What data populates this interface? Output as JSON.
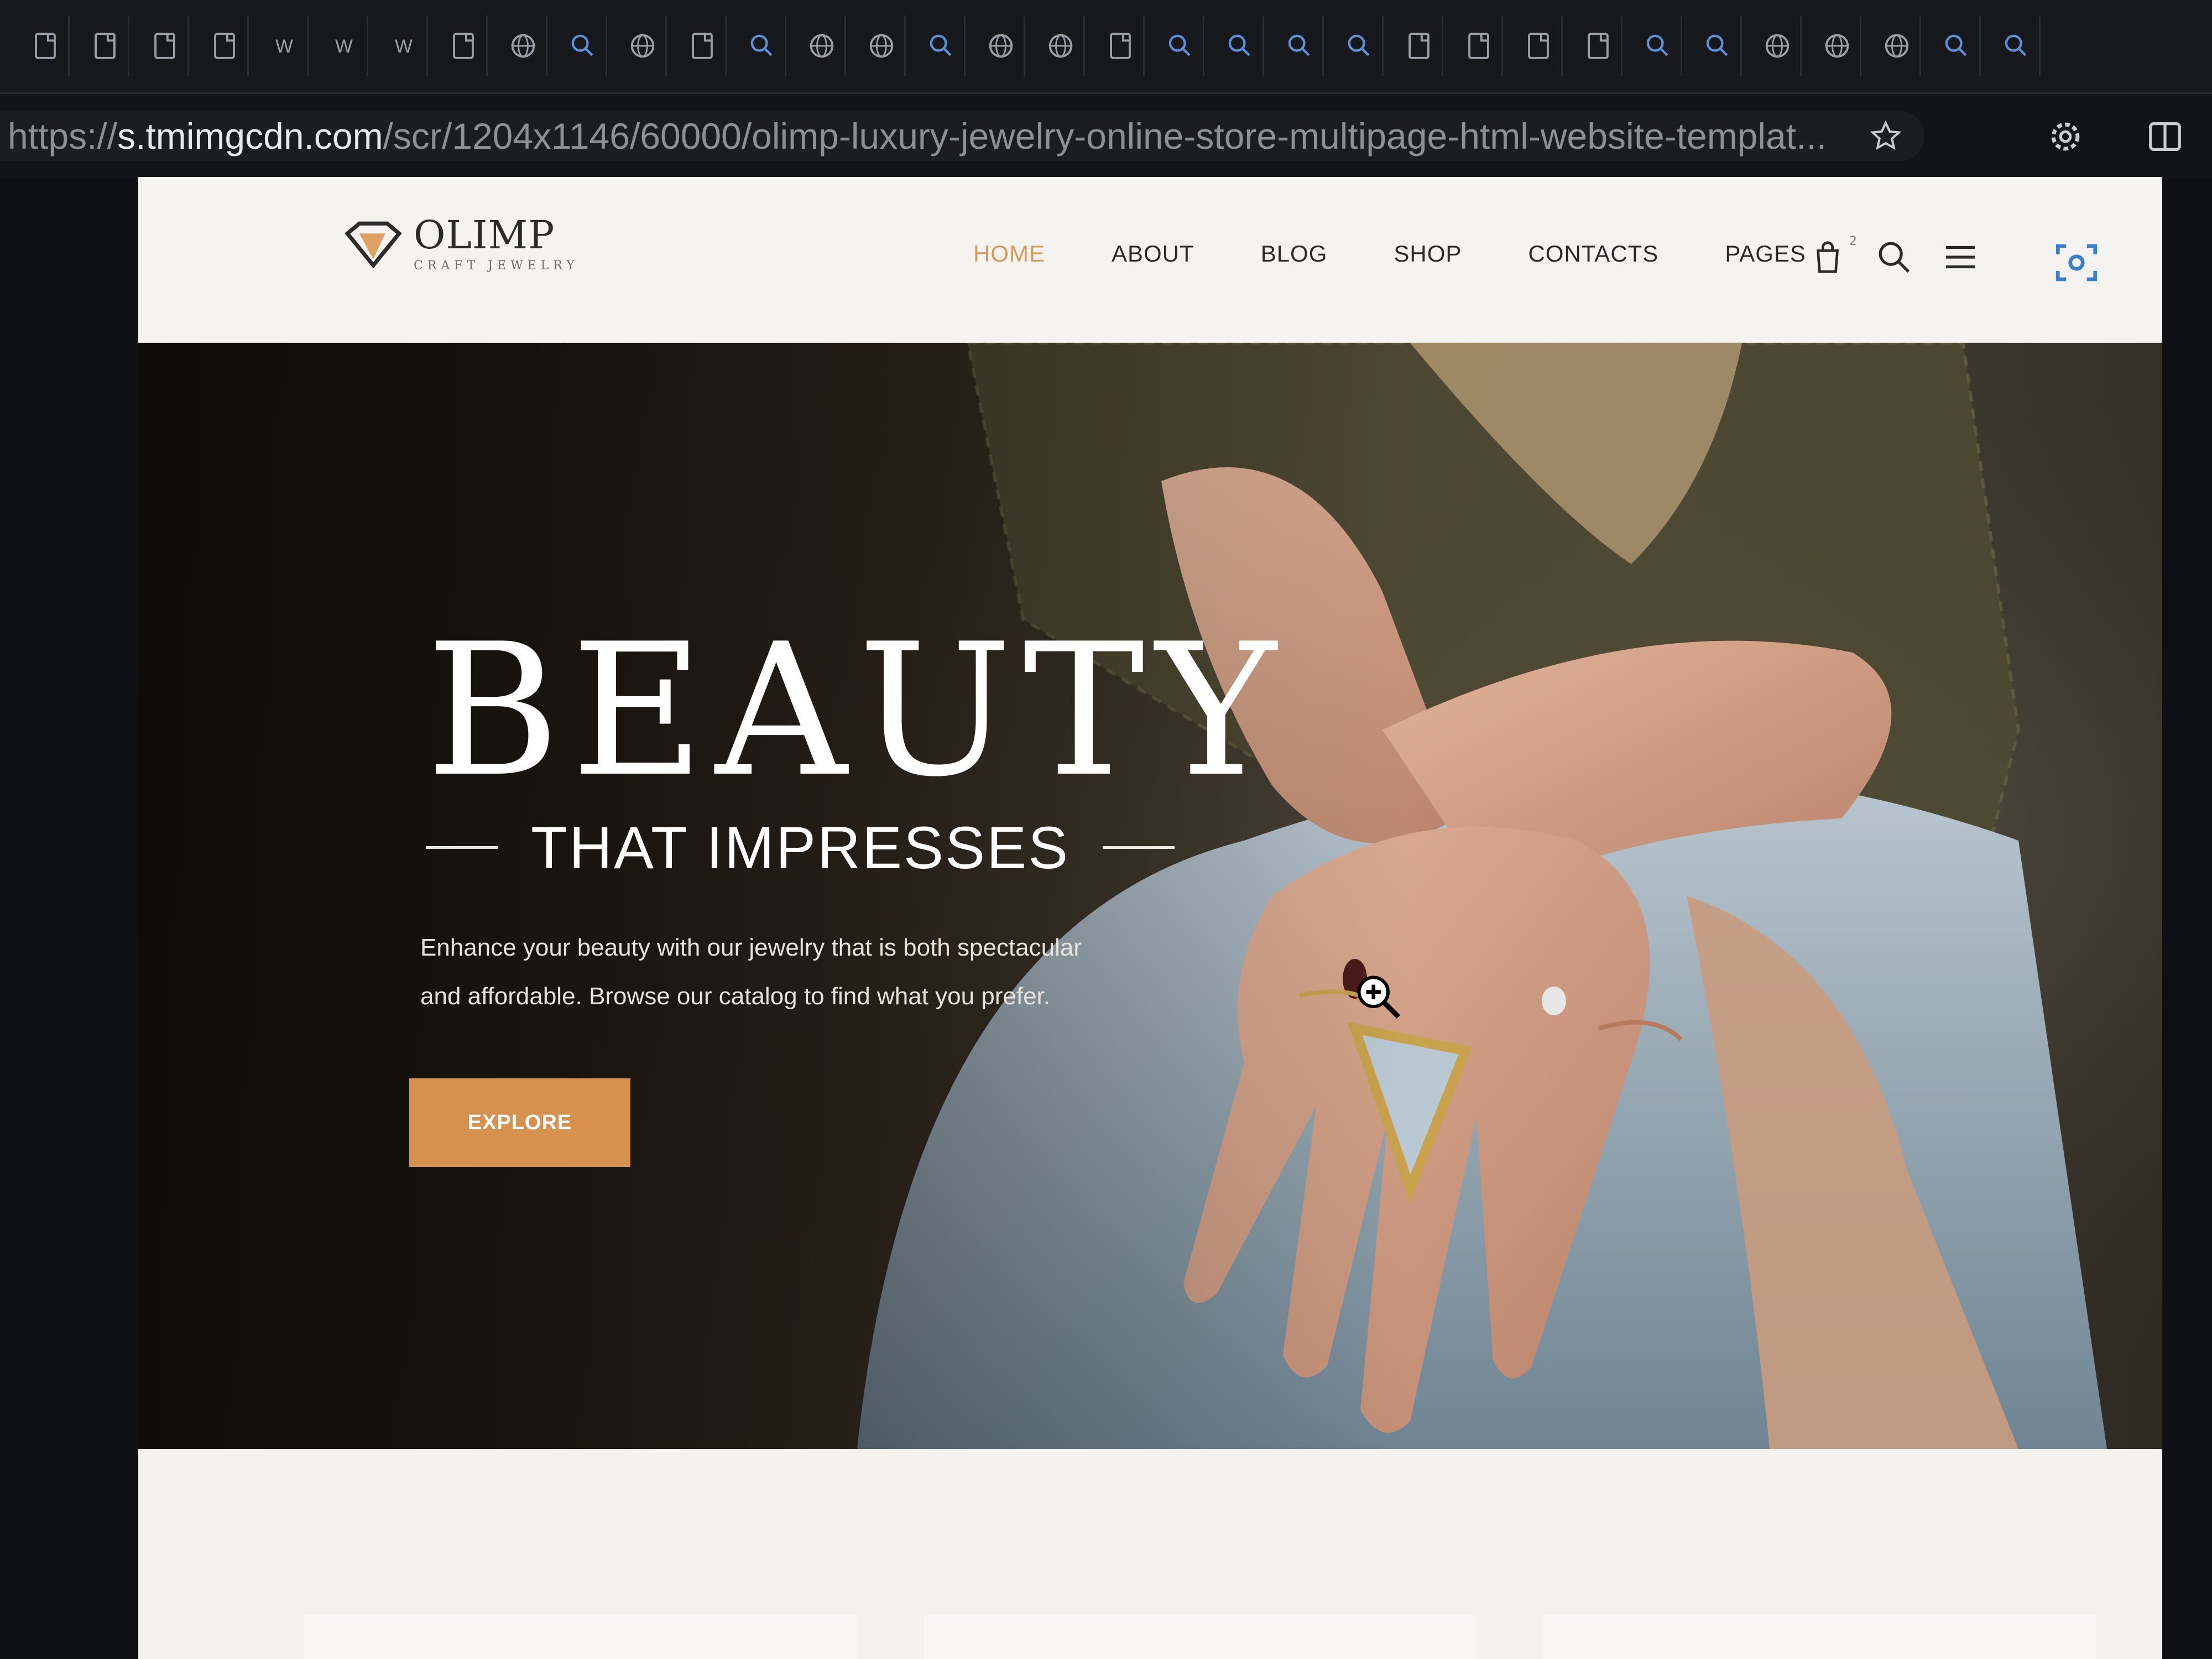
{
  "browser": {
    "tabs": [
      {
        "icon": "page-icon"
      },
      {
        "icon": "page-icon"
      },
      {
        "icon": "page-icon"
      },
      {
        "icon": "page-icon"
      },
      {
        "icon": "word-icon"
      },
      {
        "icon": "word-icon"
      },
      {
        "icon": "word-icon"
      },
      {
        "icon": "page-icon"
      },
      {
        "icon": "globe-icon"
      },
      {
        "icon": "search-icon"
      },
      {
        "icon": "globe-icon"
      },
      {
        "icon": "page-icon"
      },
      {
        "icon": "search-icon"
      },
      {
        "icon": "globe-icon"
      },
      {
        "icon": "globe-icon"
      },
      {
        "icon": "search-icon"
      },
      {
        "icon": "globe-icon"
      },
      {
        "icon": "globe-icon"
      },
      {
        "icon": "page-icon"
      },
      {
        "icon": "search-icon"
      },
      {
        "icon": "search-icon"
      },
      {
        "icon": "search-icon"
      },
      {
        "icon": "search-icon"
      },
      {
        "icon": "page-icon"
      },
      {
        "icon": "page-icon"
      },
      {
        "icon": "page-icon"
      },
      {
        "icon": "page-icon"
      },
      {
        "icon": "search-icon"
      },
      {
        "icon": "search-icon"
      },
      {
        "icon": "globe-icon"
      },
      {
        "icon": "globe-icon"
      },
      {
        "icon": "globe-icon"
      },
      {
        "icon": "search-icon"
      },
      {
        "icon": "search-icon"
      }
    ],
    "url": {
      "scheme": "https://",
      "host": "s.tmimgcdn.com",
      "path": "/scr/1204x1146/60000/olimp-luxury-jewelry-online-store-multipage-html-website-templat..."
    }
  },
  "site": {
    "logo": {
      "name": "OLIMP",
      "tagline": "CRAFT JEWELRY"
    },
    "nav": [
      {
        "label": "HOME",
        "active": true
      },
      {
        "label": "ABOUT",
        "active": false
      },
      {
        "label": "BLOG",
        "active": false
      },
      {
        "label": "SHOP",
        "active": false
      },
      {
        "label": "CONTACTS",
        "active": false
      },
      {
        "label": "PAGES",
        "active": false
      }
    ],
    "cart_count": "2",
    "colors": {
      "accent": "#d7914f",
      "active_nav": "#d79a58"
    }
  },
  "hero": {
    "title": "BEAUTY",
    "subtitle": "THAT IMPRESSES",
    "description_line1": "Enhance your beauty with our jewelry that is both spectacular",
    "description_line2": "and affordable. Browse our catalog to find what you prefer.",
    "button_label": "EXPLORE"
  }
}
